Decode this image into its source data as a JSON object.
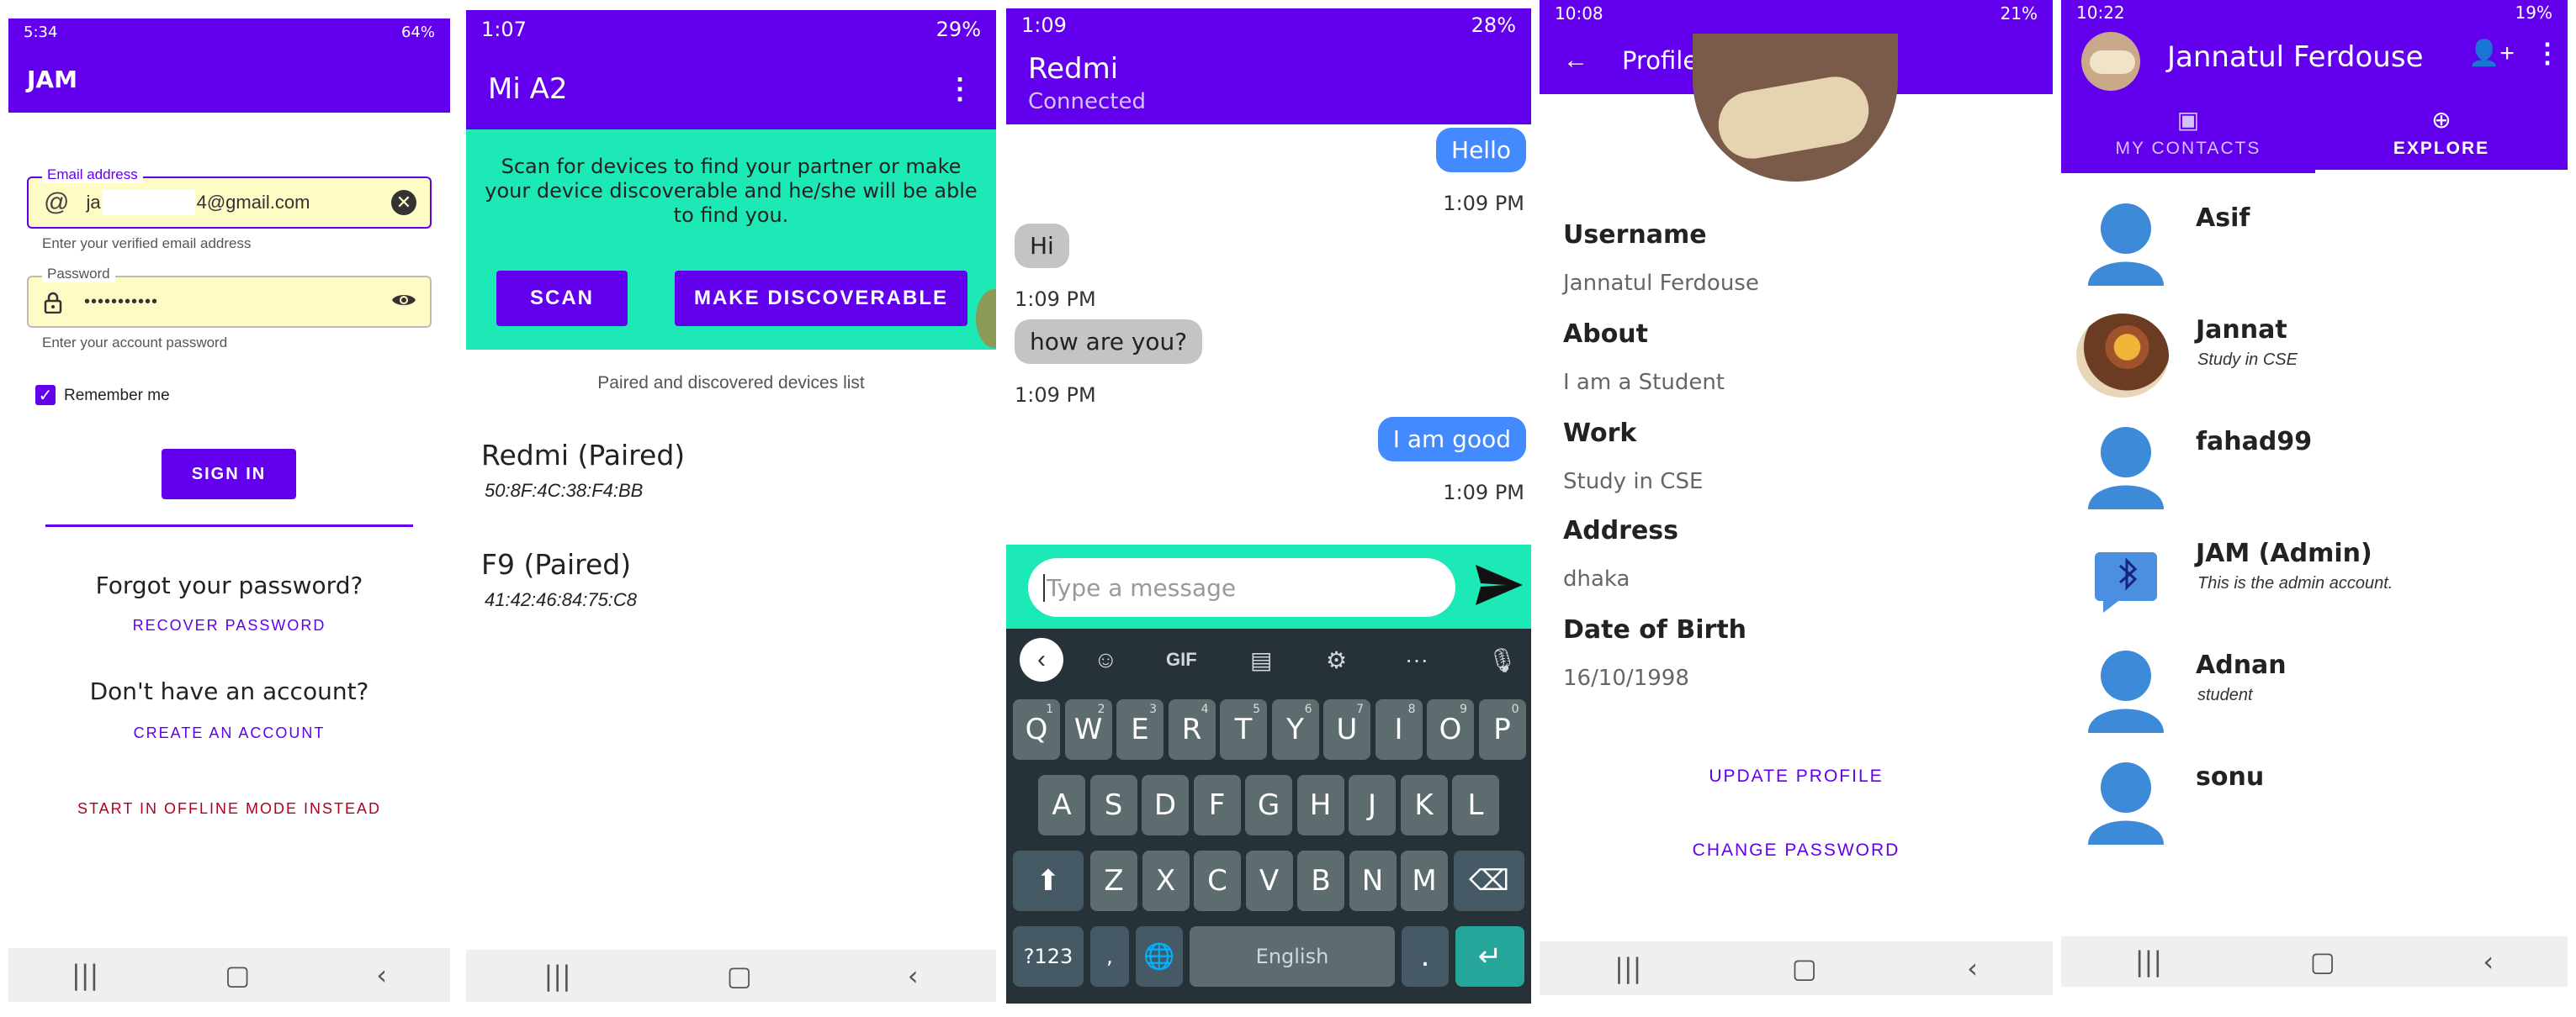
{
  "login": {
    "status": {
      "time": "5:34",
      "battery": "64%"
    },
    "title": "JAM",
    "email_label": "Email address",
    "email_value_prefix": "ja",
    "email_value_suffix": "4@gmail.com",
    "email_helper": "Enter your verified email address",
    "password_label": "Password",
    "password_value": "•••••••••••",
    "password_helper": "Enter your account password",
    "remember_label": "Remember me",
    "signin_label": "SIGN IN",
    "forgot_text": "Forgot your password?",
    "recover_label": "RECOVER PASSWORD",
    "no_account_text": "Don't have an account?",
    "create_label": "CREATE AN ACCOUNT",
    "offline_label": "START IN OFFLINE MODE INSTEAD"
  },
  "devices": {
    "status": {
      "time": "1:07",
      "battery": "29%"
    },
    "title": "Mi A2",
    "info": "Scan for devices to find your partner or make your device discoverable and he/she will be able to find you.",
    "scan_label": "SCAN",
    "discoverable_label": "MAKE DISCOVERABLE",
    "list_caption": "Paired and discovered devices list",
    "items": [
      {
        "name": "Redmi (Paired)",
        "address": "50:8F:4C:38:F4:BB"
      },
      {
        "name": "F9 (Paired)",
        "address": "41:42:46:84:75:C8"
      }
    ]
  },
  "chat": {
    "status": {
      "time": "1:09",
      "battery": "28%"
    },
    "title": "Redmi",
    "subtitle": "Connected",
    "messages": [
      {
        "text": "Hello",
        "time": "1:09 PM",
        "side": "right"
      },
      {
        "text": "Hi",
        "time": "1:09 PM",
        "side": "left"
      },
      {
        "text": "how are you?",
        "time": "1:09 PM",
        "side": "left"
      },
      {
        "text": "I am good",
        "time": "1:09 PM",
        "side": "right"
      }
    ],
    "input_placeholder": "Type a message",
    "keyboard": {
      "gif": "GIF",
      "row1": [
        "Q",
        "W",
        "E",
        "R",
        "T",
        "Y",
        "U",
        "I",
        "O",
        "P"
      ],
      "row1_nums": [
        "1",
        "2",
        "3",
        "4",
        "5",
        "6",
        "7",
        "8",
        "9",
        "0"
      ],
      "row2": [
        "A",
        "S",
        "D",
        "F",
        "G",
        "H",
        "J",
        "K",
        "L"
      ],
      "row3": [
        "Z",
        "X",
        "C",
        "V",
        "B",
        "N",
        "M"
      ],
      "sym_label": "?123",
      "comma": ",",
      "space_label": "English",
      "period": "."
    }
  },
  "profile": {
    "status": {
      "time": "10:08",
      "battery": "21%"
    },
    "title": "Profile",
    "fields": [
      {
        "label": "Username",
        "value": "Jannatul Ferdouse"
      },
      {
        "label": "About",
        "value": "I am a Student"
      },
      {
        "label": "Work",
        "value": "Study in CSE"
      },
      {
        "label": "Address",
        "value": "dhaka"
      },
      {
        "label": "Date of Birth",
        "value": "16/10/1998"
      }
    ],
    "update_label": "UPDATE PROFILE",
    "change_pw_label": "CHANGE PASSWORD"
  },
  "contacts": {
    "status": {
      "time": "10:22",
      "battery": "19%"
    },
    "title": "Jannatul Ferdouse",
    "tab_contacts": "MY CONTACTS",
    "tab_explore": "EXPLORE",
    "items": [
      {
        "name": "Asif",
        "sub": "",
        "avatar": "person"
      },
      {
        "name": "Jannat",
        "sub": "Study in CSE",
        "avatar": "photo"
      },
      {
        "name": "fahad99",
        "sub": "",
        "avatar": "person"
      },
      {
        "name": "JAM (Admin)",
        "sub": "This is the admin account.",
        "avatar": "bluetooth"
      },
      {
        "name": "Adnan",
        "sub": "student",
        "avatar": "person"
      },
      {
        "name": "sonu",
        "sub": "",
        "avatar": "person"
      }
    ]
  },
  "colors": {
    "primary": "#6200ee",
    "teal": "#1de9b6",
    "chat_blue": "#448aff",
    "bubble_grey": "#c4c4c4",
    "error_red": "#b00020"
  }
}
